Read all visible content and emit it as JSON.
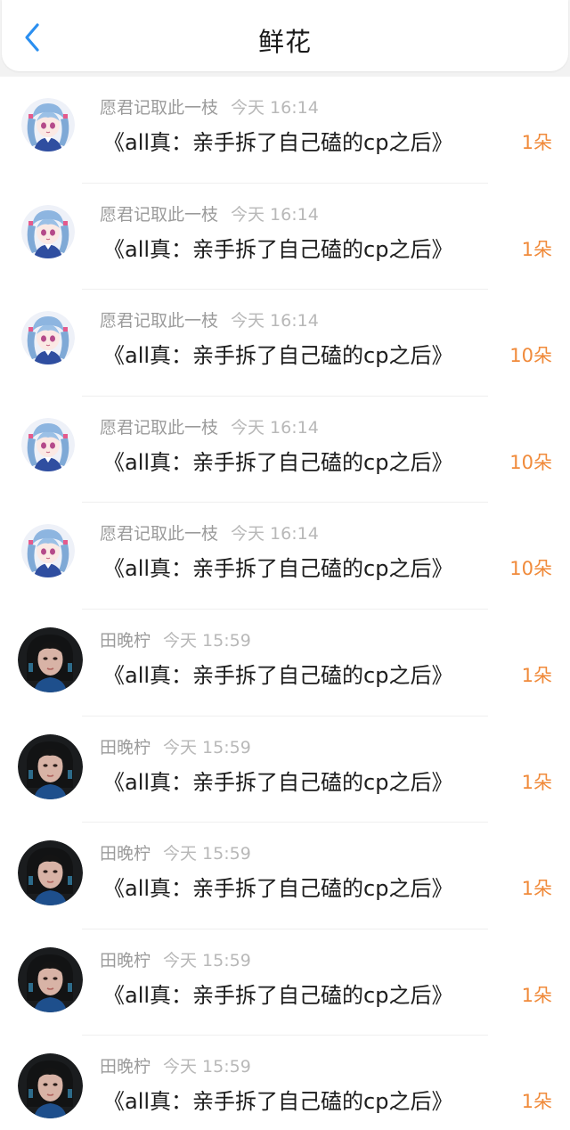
{
  "header": {
    "title": "鲜花"
  },
  "colors": {
    "accent": "#f08a3a",
    "back": "#2b8ff0"
  },
  "rows": [
    {
      "user": "愿君记取此一枝",
      "time": "今天 16:14",
      "book": "《all真：亲手拆了自己磕的cp之后》",
      "count": "1朵",
      "avatar": "anime-girl-avatar"
    },
    {
      "user": "愿君记取此一枝",
      "time": "今天 16:14",
      "book": "《all真：亲手拆了自己磕的cp之后》",
      "count": "1朵",
      "avatar": "anime-girl-avatar"
    },
    {
      "user": "愿君记取此一枝",
      "time": "今天 16:14",
      "book": "《all真：亲手拆了自己磕的cp之后》",
      "count": "10朵",
      "avatar": "anime-girl-avatar"
    },
    {
      "user": "愿君记取此一枝",
      "time": "今天 16:14",
      "book": "《all真：亲手拆了自己磕的cp之后》",
      "count": "10朵",
      "avatar": "anime-girl-avatar"
    },
    {
      "user": "愿君记取此一枝",
      "time": "今天 16:14",
      "book": "《all真：亲手拆了自己磕的cp之后》",
      "count": "10朵",
      "avatar": "anime-girl-avatar"
    },
    {
      "user": "田晚柠",
      "time": "今天 15:59",
      "book": "《all真：亲手拆了自己磕的cp之后》",
      "count": "1朵",
      "avatar": "photo-avatar"
    },
    {
      "user": "田晚柠",
      "time": "今天 15:59",
      "book": "《all真：亲手拆了自己磕的cp之后》",
      "count": "1朵",
      "avatar": "photo-avatar"
    },
    {
      "user": "田晚柠",
      "time": "今天 15:59",
      "book": "《all真：亲手拆了自己磕的cp之后》",
      "count": "1朵",
      "avatar": "photo-avatar"
    },
    {
      "user": "田晚柠",
      "time": "今天 15:59",
      "book": "《all真：亲手拆了自己磕的cp之后》",
      "count": "1朵",
      "avatar": "photo-avatar"
    },
    {
      "user": "田晚柠",
      "time": "今天 15:59",
      "book": "《all真：亲手拆了自己磕的cp之后》",
      "count": "1朵",
      "avatar": "photo-avatar"
    }
  ]
}
